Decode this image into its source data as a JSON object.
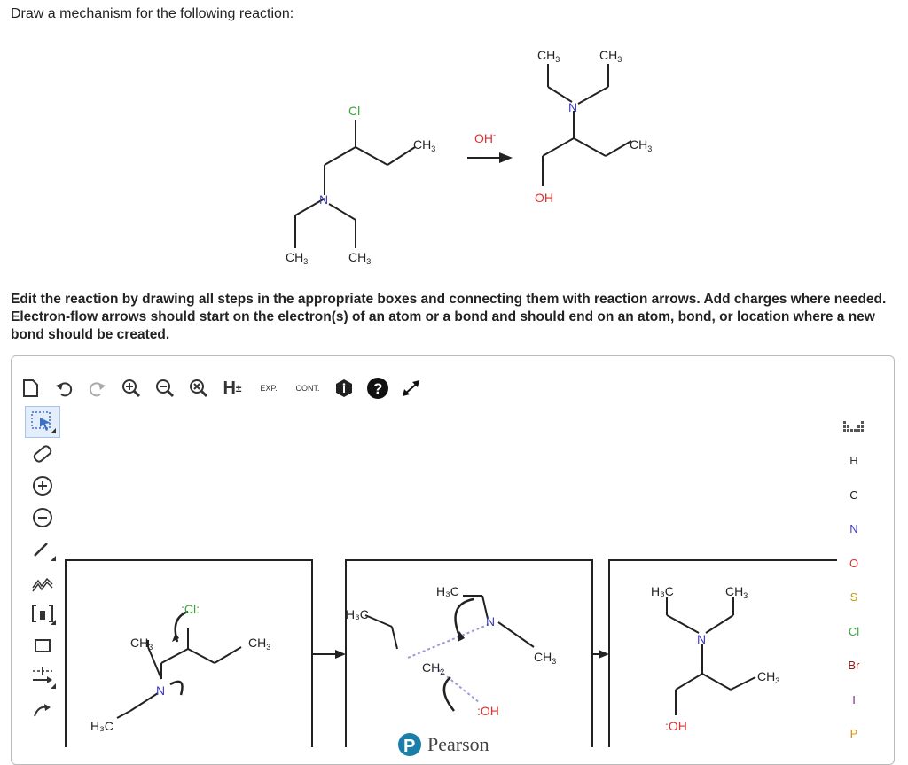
{
  "prompt": "Draw a mechanism for the following reaction:",
  "reaction": {
    "reactant": {
      "cl": "Cl",
      "ch3_right": "CH",
      "n": "N",
      "ch3_a": "CH",
      "ch3_b": "CH",
      "sub": "3"
    },
    "reagent": "OH",
    "product": {
      "ch3_a": "CH",
      "ch3_b": "CH",
      "n": "N",
      "ch3_right": "CH",
      "oh": "OH"
    }
  },
  "instructions": "Edit the reaction by drawing all steps in the appropriate boxes and connecting them with reaction arrows. Add charges where needed. Electron-flow arrows should start on the electron(s) of an atom or a bond and should end on an atom, bond, or location where a new bond should be created.",
  "toolbar": {
    "h_label": "H",
    "exp_label": "EXP.",
    "cont_label": "CONT."
  },
  "canvas": {
    "box1": {
      "cl": ":Cl:",
      "ch3_a": "CH",
      "ch3_b": "CH",
      "n": "N",
      "h3c": "H₃C"
    },
    "box2": {
      "h3c_a": "H₃C",
      "h3c_b": "H₃C",
      "n": "N",
      "ch2": "CH",
      "ch3": "CH",
      "oh": ":OH"
    },
    "box3": {
      "h3c": "H₃C",
      "ch3_a": "CH",
      "n": "N",
      "ch3_b": "CH",
      "oh": ":OH"
    }
  },
  "periodic_table": [
    "H",
    "C",
    "N",
    "O",
    "S",
    "Cl",
    "Br",
    "I",
    "P"
  ],
  "colors": {
    "cl": "#3aa53a",
    "n": "#3b3bc8",
    "o": "#e03030",
    "p": "#d68b1a",
    "arrow": "#222"
  },
  "brand": "Pearson"
}
